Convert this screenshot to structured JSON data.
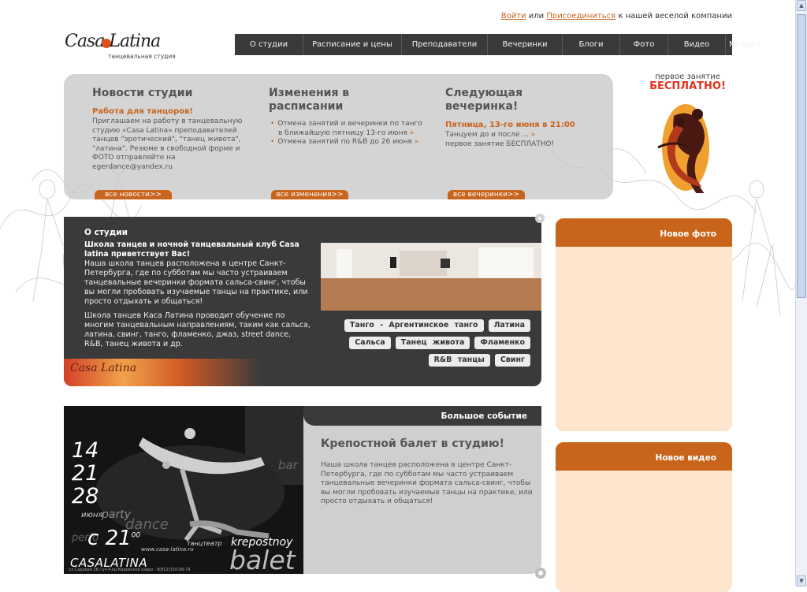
{
  "header": {
    "login": "Войти",
    "or": "или",
    "join": "Присоединиться",
    "join_suffix": "к нашей веселой компании"
  },
  "logo": {
    "name_left": "Casa",
    "name_right": "Latina",
    "tagline": "танцевальная студия"
  },
  "nav": {
    "items": [
      "О студии",
      "Расписание и цены",
      "Преподаватели",
      "Вечеринки",
      "Блоги",
      "Фото",
      "Видео",
      "Музыка"
    ]
  },
  "news": {
    "title": "Новости студии",
    "subtitle": "Работа для танцоров!",
    "text": "Приглашаем на работу в танцевальную студию «Casa Latina» преподавателей танцев \"эротический\", \"танец живота\", \"латина\". Резюме в свободной форме и ФОТО отправляйте на egerdance@yandex.ru",
    "more": "все новости>>"
  },
  "schedule": {
    "title": "Изменения в расписании",
    "items": [
      {
        "text": "Отмена занятий и вечеринки по танго в ближайшую пятницу 13-го июня",
        "arrow": "»"
      },
      {
        "text": "Отмена занятий по R&B до 26 июня",
        "arrow": "»"
      }
    ],
    "more": "все изменения>>"
  },
  "party": {
    "title": "Следующая вечеринка!",
    "date": "Пятница, 13-го июня в 21:00",
    "line1": "Танцуем до и после ...",
    "arrow": "»",
    "line2": "первое занятие БЕСПЛАТНО!",
    "more": "все вечеринки>>"
  },
  "promo": {
    "line1": "первое занятие",
    "line2": "БЕСПЛАТНО!"
  },
  "about": {
    "title": "О студии",
    "lead": "Школа танцев и ночной танцевальный клуб Casa latina приветствует Вас!",
    "body1": "Наша школа танцев расположена в центре Санкт-Петербурга, где по субботам мы часто устраиваем танцевальные вечеринки формата сальса-свинг, чтобы вы могли пробовать изучаемые танцы на практике, или просто отдыхать и общаться!",
    "body2": "Школа танцев Каса Латина проводит обучение по многим танцевальным направлениям, таким как сальса, латина, свинг, танго, фламенко, джаз, street dance, R&B, танец живота и др.",
    "tags": [
      "Танго - Аргентинское танго",
      "Латина",
      "Сальса",
      "Танец живота",
      "Фламенко",
      "R&B танцы",
      "Свинг"
    ],
    "strip_logo": "Casa Latina"
  },
  "side": {
    "new_photo": "Новое фото",
    "new_video": "Новое видео"
  },
  "event": {
    "header": "Большое событие",
    "title": "Крепостной балет в студию!",
    "text": "Наша школа танцев расположена в центре Санкт-Петербурга, где по субботам мы часто устраиваем танцевальные вечеринки формата сальса-свинг, чтобы вы могли пробовать изучаемые танцы на практике, или просто отдыхать и общаться!",
    "poster": {
      "d1": "14",
      "d2": "21",
      "d3": "28",
      "month": "июня",
      "party": "party",
      "dance": "dance",
      "perf": "perfo",
      "c": "с",
      "time_h": "21",
      "time_m": "00",
      "teatr": "танцтеатр",
      "krep": "krepostnoy",
      "balet": "balet",
      "bar": "bar",
      "site": "www.casa-latina.ru",
      "brand": "CASALATINA",
      "addr": "ул.Садовая 28 / уч.4,кр.Кировское озеро · 8(812)310-06-79"
    }
  },
  "colors": {
    "accent": "#c8641c",
    "dark": "#3a3a3a",
    "cream": "#fde6cd"
  }
}
